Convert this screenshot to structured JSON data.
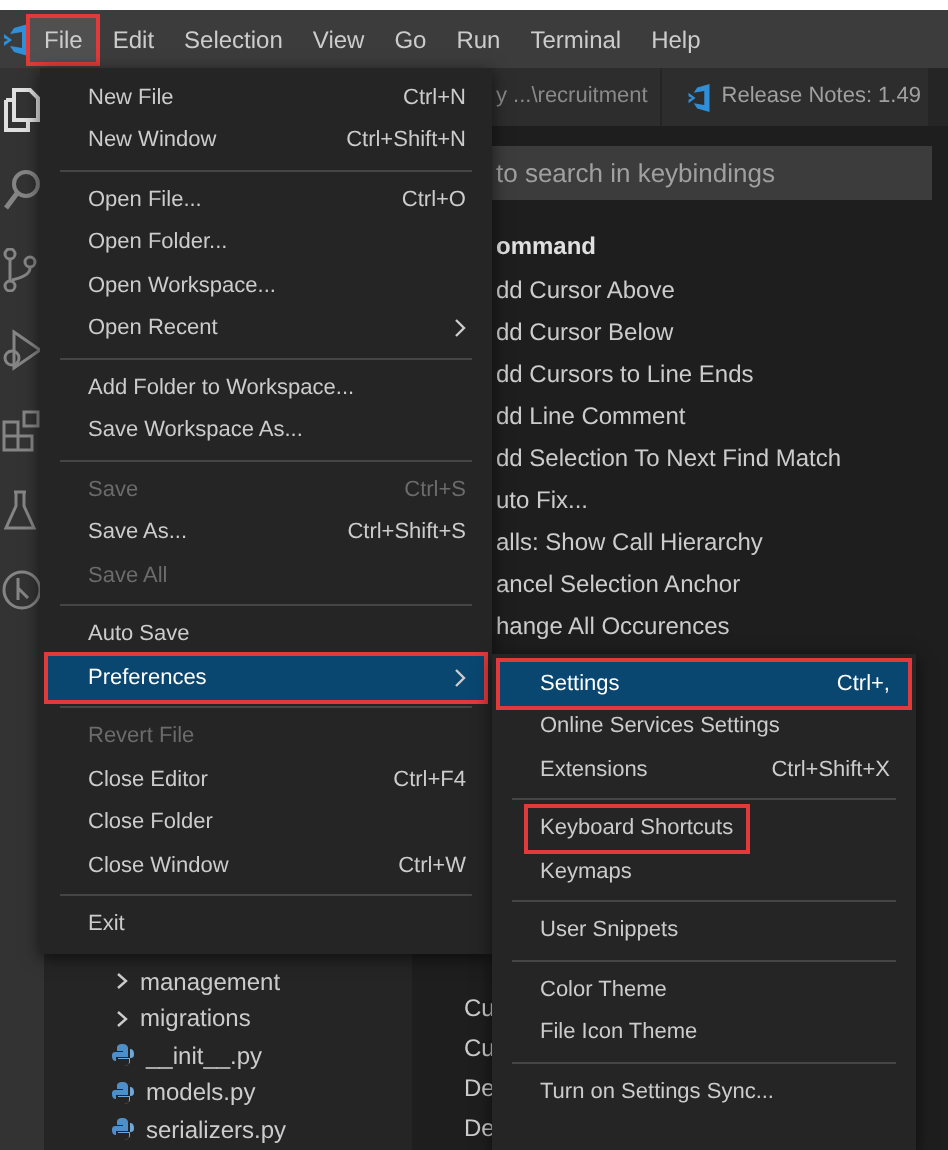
{
  "menubar": [
    {
      "label": "File",
      "selected": true,
      "highlighted": true
    },
    {
      "label": "Edit",
      "selected": false,
      "highlighted": false
    },
    {
      "label": "Selection",
      "selected": false,
      "highlighted": false
    },
    {
      "label": "View",
      "selected": false,
      "highlighted": false
    },
    {
      "label": "Go",
      "selected": false,
      "highlighted": false
    },
    {
      "label": "Run",
      "selected": false,
      "highlighted": false
    },
    {
      "label": "Terminal",
      "selected": false,
      "highlighted": false
    },
    {
      "label": "Help",
      "selected": false,
      "highlighted": false
    }
  ],
  "editor_tabs": [
    {
      "label": "y ...\\recruitment",
      "kind": "plain"
    },
    {
      "label": "Release Notes: 1.49",
      "kind": "vscode"
    }
  ],
  "keybindings_search": {
    "placeholder": "to search in keybindings"
  },
  "keybindings_header": "ommand",
  "keybindings_rows": [
    "dd Cursor Above",
    "dd Cursor Below",
    "dd Cursors to Line Ends",
    "dd Line Comment",
    "dd Selection To Next Find Match",
    "uto Fix...",
    "alls: Show Call Hierarchy",
    "ancel Selection Anchor",
    "hange All Occurences"
  ],
  "keybindings_rows_lower": [
    "Cu",
    "Cu",
    "De",
    "De"
  ],
  "explorer": [
    {
      "kind": "folder",
      "label": "management"
    },
    {
      "kind": "folder",
      "label": "migrations"
    },
    {
      "kind": "python",
      "label": "__init__.py"
    },
    {
      "kind": "python",
      "label": "models.py"
    },
    {
      "kind": "python",
      "label": "serializers.py"
    }
  ],
  "file_menu": [
    {
      "kind": "item",
      "label": "New File",
      "shortcut": "Ctrl+N",
      "disabled": false,
      "selected": false,
      "highlighted": false,
      "submenu": false
    },
    {
      "kind": "item",
      "label": "New Window",
      "shortcut": "Ctrl+Shift+N",
      "disabled": false,
      "selected": false,
      "highlighted": false,
      "submenu": false
    },
    {
      "kind": "separator"
    },
    {
      "kind": "item",
      "label": "Open File...",
      "shortcut": "Ctrl+O",
      "disabled": false,
      "selected": false,
      "highlighted": false,
      "submenu": false
    },
    {
      "kind": "item",
      "label": "Open Folder...",
      "disabled": false,
      "selected": false,
      "highlighted": false,
      "submenu": false
    },
    {
      "kind": "item",
      "label": "Open Workspace...",
      "disabled": false,
      "selected": false,
      "highlighted": false,
      "submenu": false
    },
    {
      "kind": "item",
      "label": "Open Recent",
      "disabled": false,
      "selected": false,
      "highlighted": false,
      "submenu": true
    },
    {
      "kind": "separator"
    },
    {
      "kind": "item",
      "label": "Add Folder to Workspace...",
      "disabled": false,
      "selected": false,
      "highlighted": false,
      "submenu": false
    },
    {
      "kind": "item",
      "label": "Save Workspace As...",
      "disabled": false,
      "selected": false,
      "highlighted": false,
      "submenu": false
    },
    {
      "kind": "separator"
    },
    {
      "kind": "item",
      "label": "Save",
      "shortcut": "Ctrl+S",
      "disabled": true,
      "selected": false,
      "highlighted": false,
      "submenu": false
    },
    {
      "kind": "item",
      "label": "Save As...",
      "shortcut": "Ctrl+Shift+S",
      "disabled": false,
      "selected": false,
      "highlighted": false,
      "submenu": false
    },
    {
      "kind": "item",
      "label": "Save All",
      "disabled": true,
      "selected": false,
      "highlighted": false,
      "submenu": false
    },
    {
      "kind": "separator"
    },
    {
      "kind": "item",
      "label": "Auto Save",
      "disabled": false,
      "selected": false,
      "highlighted": false,
      "submenu": false
    },
    {
      "kind": "item",
      "label": "Preferences",
      "disabled": false,
      "selected": true,
      "highlighted": true,
      "submenu": true
    },
    {
      "kind": "separator"
    },
    {
      "kind": "item",
      "label": "Revert File",
      "disabled": true,
      "selected": false,
      "highlighted": false,
      "submenu": false
    },
    {
      "kind": "item",
      "label": "Close Editor",
      "shortcut": "Ctrl+F4",
      "disabled": false,
      "selected": false,
      "highlighted": false,
      "submenu": false
    },
    {
      "kind": "item",
      "label": "Close Folder",
      "disabled": false,
      "selected": false,
      "highlighted": false,
      "submenu": false
    },
    {
      "kind": "item",
      "label": "Close Window",
      "shortcut": "Ctrl+W",
      "disabled": false,
      "selected": false,
      "highlighted": false,
      "submenu": false
    },
    {
      "kind": "separator"
    },
    {
      "kind": "item",
      "label": "Exit",
      "disabled": false,
      "selected": false,
      "highlighted": false,
      "submenu": false
    }
  ],
  "preferences_menu": [
    {
      "kind": "item",
      "label": "Settings",
      "shortcut": "Ctrl+,",
      "selected": true,
      "highlighted": true
    },
    {
      "kind": "item",
      "label": "Online Services Settings",
      "selected": false,
      "highlighted": false
    },
    {
      "kind": "item",
      "label": "Extensions",
      "shortcut": "Ctrl+Shift+X",
      "selected": false,
      "highlighted": false
    },
    {
      "kind": "separator"
    },
    {
      "kind": "item",
      "label": "Keyboard Shortcuts",
      "selected": false,
      "highlighted": true
    },
    {
      "kind": "item",
      "label": "Keymaps",
      "selected": false,
      "highlighted": false
    },
    {
      "kind": "separator"
    },
    {
      "kind": "item",
      "label": "User Snippets",
      "selected": false,
      "highlighted": false
    },
    {
      "kind": "separator"
    },
    {
      "kind": "item",
      "label": "Color Theme",
      "selected": false,
      "highlighted": false
    },
    {
      "kind": "item",
      "label": "File Icon Theme",
      "selected": false,
      "highlighted": false
    },
    {
      "kind": "separator"
    },
    {
      "kind": "item",
      "label": "Turn on Settings Sync...",
      "selected": false,
      "highlighted": false
    }
  ]
}
